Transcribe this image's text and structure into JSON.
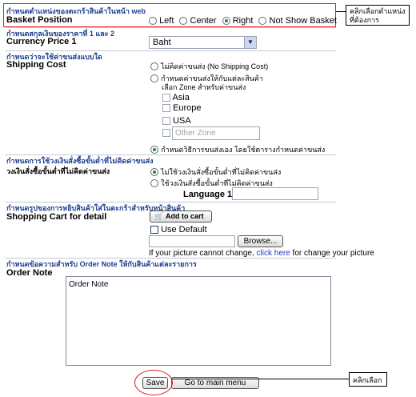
{
  "basket": {
    "section_title": "กำหนดตำแหน่งของตะกร้าสินค้าในหน้า web",
    "label": "Basket Position",
    "options": [
      "Left",
      "Center",
      "Right",
      "Not Show Basket"
    ],
    "selected": "Right"
  },
  "currency": {
    "section_title": "กำหนดสกุลเงินของราคาที่ 1 และ 2",
    "label": "Currency Price 1",
    "value": "Baht"
  },
  "shipping": {
    "section_title": "กำหนดว่าจะใช้ค่าขนส่งแบบใด",
    "label": "Shipping Cost",
    "option_none": "ไม่คิดค่าขนส่ง (No Shipping Cost)",
    "option_zone_line1": "กำหนดค่าขนส่งให้กับแต่ละสินค้า",
    "option_zone_line2": "เลือก Zone สำหรับค่าขนส่ง",
    "zones": [
      "Asia",
      "Europe",
      "USA"
    ],
    "other_zone_placeholder": "Other Zone",
    "option_table": "กำหนดวิธีการขนส่งเอง โดยใช้ตารางกำหนดค่าขนส่ง"
  },
  "minimum": {
    "section_title": "กำหนดการใช้วงเงินสั่งซื้อขั้นต่ำที่ไม่คิดค่าขนส่ง",
    "label": "วงเงินสั่งซื้อขั้นต่ำที่ไม่คิดค่าขนส่ง",
    "option_off": "ไม่ใช้วงเงินสั่งซื้อขั้นต่ำที่ไม่คิดค่าขนส่ง",
    "option_on": "ใช้วงเงินสั่งซื้อขั้นต่ำที่ไม่คิดค่าขนส่ง",
    "language_label": "Language 1"
  },
  "cart_image": {
    "section_title": "กำหนดรูปของการหยิบสินค้าใส่ในตะกร้าสำหรับหน้าสินค้า",
    "label": "Shopping Cart for detail",
    "add_to_cart": "Add to cart",
    "use_default": "Use Default",
    "browse": "Browse...",
    "note_prefix": "If your picture cannot change, ",
    "note_link": "click here",
    "note_suffix": " for change your picture"
  },
  "order_note": {
    "section_title": "กำหนดข้อความสำหรับ Order Note ให้กับสินค้าแต่ละรายการ",
    "label": "Order Note",
    "value": "Order Note"
  },
  "buttons": {
    "save": "Save",
    "main_menu": "Go to main menu"
  },
  "callouts": {
    "top": "คลิกเลือกตำแหน่งที่ต้องการ",
    "bottom": "คลิกเลือก"
  },
  "colors": {
    "annotation_red": "#e0202a",
    "section_blue": "#1f3f8f",
    "link_blue": "#1a3cc8"
  }
}
